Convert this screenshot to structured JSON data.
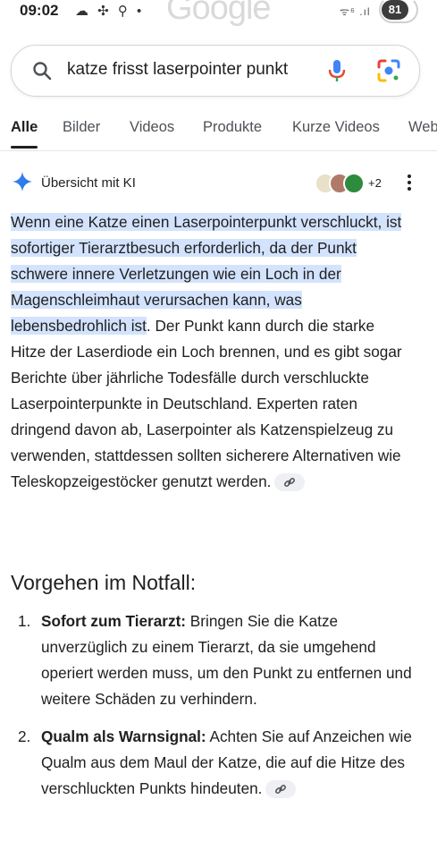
{
  "status_bar": {
    "time": "09:02",
    "icons_left": "☁ ✣ ⚲ •",
    "icons_right": "ᯤ⁶ .ıl",
    "battery": "81"
  },
  "google_logo_text": "Google",
  "search": {
    "query": "katze frisst laserpointer punkt",
    "search_icon": "search-icon",
    "mic_icon": "mic-icon",
    "lens_icon": "lens-icon"
  },
  "tabs": [
    {
      "label": "Alle",
      "active": true
    },
    {
      "label": "Bilder",
      "active": false
    },
    {
      "label": "Videos",
      "active": false
    },
    {
      "label": "Produkte",
      "active": false
    },
    {
      "label": "Kurze Videos",
      "active": false
    },
    {
      "label": "Web",
      "active": false
    }
  ],
  "ai_overview": {
    "title": "Übersicht mit KI",
    "sources_more": "+2",
    "highlighted": "Wenn eine Katze einen Laserpointerpunkt verschluckt, ist sofortiger Tierarztbesuch erforderlich, da der Punkt schwere innere Verletzungen wie ein Loch in der Magenschleimhaut verursachen kann, was lebensbedrohlich ist",
    "rest": ". Der Punkt kann durch die starke Hitze der Laserdiode ein Loch brennen, und es gibt sogar Berichte über jährliche Todesfälle durch verschluckte Laserpointerpunkte in Deutschland. Experten raten dringend davon ab, Laserpointer als Katzenspielzeug zu verwenden, stattdessen sollten sicherere Alternativen wie Teleskopzeigestöcker genutzt werden."
  },
  "emergency": {
    "heading": "Vorgehen im Notfall:",
    "items": [
      {
        "num": "1.",
        "title": "Sofort zum Tierarzt:",
        "text": " Bringen Sie die Katze unverzüglich zu einem Tierarzt, da sie umgehend operiert werden muss, um den Punkt zu entfernen und weitere Schäden zu verhindern."
      },
      {
        "num": "2.",
        "title": "Qualm als Warnsignal:",
        "text": " Achten Sie auf Anzeichen wie Qualm aus dem Maul der Katze, die auf die Hitze des verschluckten Punkts hindeuten."
      }
    ]
  },
  "colors": {
    "highlight": "#d3e3fd",
    "google_blue": "#4285f4",
    "google_red": "#ea4335",
    "google_yellow": "#fbbc05",
    "google_green": "#34a853"
  }
}
